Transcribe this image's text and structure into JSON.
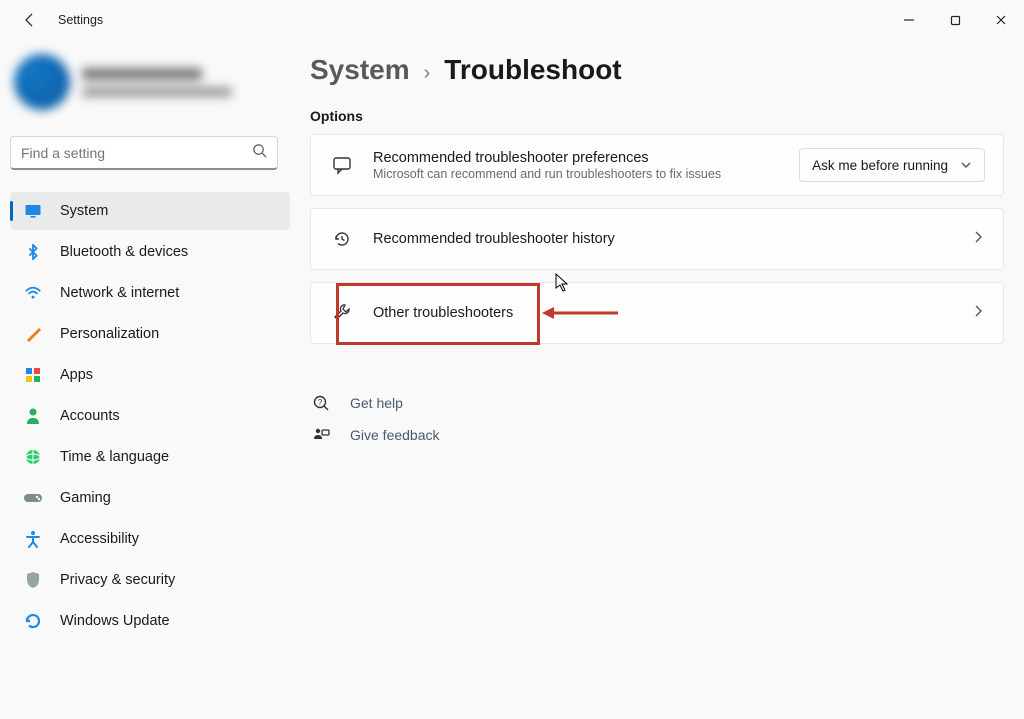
{
  "window": {
    "title": "Settings"
  },
  "search": {
    "placeholder": "Find a setting"
  },
  "nav": {
    "items": [
      {
        "label": "System"
      },
      {
        "label": "Bluetooth & devices"
      },
      {
        "label": "Network & internet"
      },
      {
        "label": "Personalization"
      },
      {
        "label": "Apps"
      },
      {
        "label": "Accounts"
      },
      {
        "label": "Time & language"
      },
      {
        "label": "Gaming"
      },
      {
        "label": "Accessibility"
      },
      {
        "label": "Privacy & security"
      },
      {
        "label": "Windows Update"
      }
    ]
  },
  "breadcrumb": {
    "parent": "System",
    "current": "Troubleshoot"
  },
  "section_label": "Options",
  "options": {
    "rec_prefs": {
      "title": "Recommended troubleshooter preferences",
      "subtitle": "Microsoft can recommend and run troubleshooters to fix issues",
      "select_value": "Ask me before running"
    },
    "rec_history": {
      "title": "Recommended troubleshooter history"
    },
    "other": {
      "title": "Other troubleshooters"
    }
  },
  "footer": {
    "help": "Get help",
    "feedback": "Give feedback"
  }
}
